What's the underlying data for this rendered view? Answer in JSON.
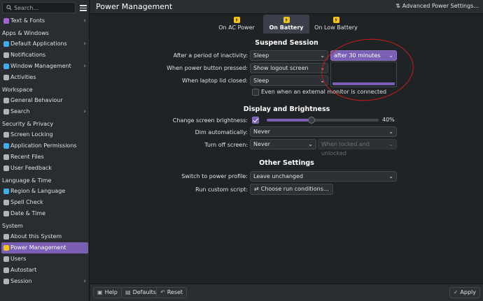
{
  "sidebar": {
    "search_placeholder": "Search...",
    "sections": [
      {
        "title": "",
        "items": [
          {
            "label": "Text & Fonts",
            "icon": "text-fonts-icon",
            "color": "#a066d3",
            "chevron": true
          }
        ]
      },
      {
        "title": "Apps & Windows",
        "items": [
          {
            "label": "Default Applications",
            "icon": "default-apps-icon",
            "color": "#3daee9",
            "chevron": true
          },
          {
            "label": "Notifications",
            "icon": "notifications-icon",
            "color": "#b0b3b8",
            "chevron": false
          },
          {
            "label": "Window Management",
            "icon": "window-management-icon",
            "color": "#3daee9",
            "chevron": true
          },
          {
            "label": "Activities",
            "icon": "activities-icon",
            "color": "#b0b3b8",
            "chevron": false
          }
        ]
      },
      {
        "title": "Workspace",
        "items": [
          {
            "label": "General Behaviour",
            "icon": "general-behaviour-icon",
            "color": "#b0b3b8",
            "chevron": false
          },
          {
            "label": "Search",
            "icon": "search-icon",
            "color": "#b0b3b8",
            "chevron": true
          }
        ]
      },
      {
        "title": "Security & Privacy",
        "items": [
          {
            "label": "Screen Locking",
            "icon": "screen-locking-icon",
            "color": "#b0b3b8",
            "chevron": false
          },
          {
            "label": "Application Permissions",
            "icon": "app-permissions-icon",
            "color": "#3daee9",
            "chevron": false
          },
          {
            "label": "Recent Files",
            "icon": "recent-files-icon",
            "color": "#b0b3b8",
            "chevron": false
          },
          {
            "label": "User Feedback",
            "icon": "user-feedback-icon",
            "color": "#b0b3b8",
            "chevron": false
          }
        ]
      },
      {
        "title": "Language & Time",
        "items": [
          {
            "label": "Region & Language",
            "icon": "region-language-icon",
            "color": "#3daee9",
            "chevron": false
          },
          {
            "label": "Spell Check",
            "icon": "spell-check-icon",
            "color": "#b0b3b8",
            "chevron": false
          },
          {
            "label": "Date & Time",
            "icon": "date-time-icon",
            "color": "#b0b3b8",
            "chevron": false
          }
        ]
      },
      {
        "title": "System",
        "items": [
          {
            "label": "About this System",
            "icon": "about-system-icon",
            "color": "#b0b3b8",
            "chevron": false
          },
          {
            "label": "Power Management",
            "icon": "power-management-icon",
            "color": "#f5c518",
            "chevron": false,
            "active": true
          },
          {
            "label": "Users",
            "icon": "users-icon",
            "color": "#b0b3b8",
            "chevron": false
          },
          {
            "label": "Autostart",
            "icon": "autostart-icon",
            "color": "#b0b3b8",
            "chevron": false
          },
          {
            "label": "Session",
            "icon": "session-icon",
            "color": "#b0b3b8",
            "chevron": true
          }
        ]
      }
    ]
  },
  "header": {
    "title": "Power Management",
    "advanced_label": "Advanced Power Settings..."
  },
  "tabs": [
    {
      "label": "On AC Power"
    },
    {
      "label": "On Battery",
      "active": true
    },
    {
      "label": "On Low Battery"
    }
  ],
  "suspend": {
    "title": "Suspend Session",
    "inactivity_label": "After a period of inactivity:",
    "inactivity_value": "Sleep",
    "inactivity_delay": "after 30 minutes",
    "power_button_label": "When power button pressed:",
    "power_button_value": "Show logout screen",
    "lid_label": "When laptop lid closed:",
    "lid_value": "Sleep",
    "external_monitor_label": "Even when an external monitor is connected"
  },
  "display": {
    "title": "Display and Brightness",
    "brightness_label": "Change screen brightness:",
    "brightness_value": "40%",
    "brightness_fraction": 0.4,
    "dim_label": "Dim automatically:",
    "dim_value": "Never",
    "turn_off_label": "Turn off screen:",
    "turn_off_value": "Never",
    "turn_off_locked_value": "When locked and unlocked"
  },
  "other": {
    "title": "Other Settings",
    "profile_label": "Switch to power profile:",
    "profile_value": "Leave unchanged",
    "script_label": "Run custom script:",
    "script_button": "Choose run conditions..."
  },
  "footer": {
    "help": "Help",
    "defaults": "Defaults",
    "reset": "Reset",
    "apply": "Apply"
  },
  "colors": {
    "accent": "#7a5fb5",
    "annotation": "#c81a1a"
  }
}
